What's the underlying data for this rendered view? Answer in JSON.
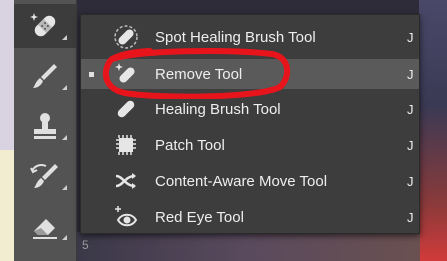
{
  "toolbar": {
    "tools": [
      {
        "icon": "spot-healing-bandage-icon",
        "active": true
      },
      {
        "icon": "brush-icon",
        "active": false
      },
      {
        "icon": "clone-stamp-icon",
        "active": false
      },
      {
        "icon": "history-brush-icon",
        "active": false
      },
      {
        "icon": "eraser-icon",
        "active": false
      }
    ],
    "bottom_text": "5"
  },
  "flyout": {
    "items": [
      {
        "label": "Spot Healing Brush Tool",
        "shortcut": "J",
        "icon": "spot-healing-brush-icon"
      },
      {
        "label": "Remove Tool",
        "shortcut": "J",
        "icon": "remove-tool-icon",
        "selected": true
      },
      {
        "label": "Healing Brush Tool",
        "shortcut": "J",
        "icon": "healing-brush-icon"
      },
      {
        "label": "Patch Tool",
        "shortcut": "J",
        "icon": "patch-tool-icon"
      },
      {
        "label": "Content-Aware Move Tool",
        "shortcut": "J",
        "icon": "content-aware-move-icon"
      },
      {
        "label": "Red Eye Tool",
        "shortcut": "J",
        "icon": "red-eye-icon"
      }
    ]
  },
  "colors": {
    "annotation": "#e8141c",
    "panel": "#3d3d3d",
    "toolbar": "#535353"
  }
}
